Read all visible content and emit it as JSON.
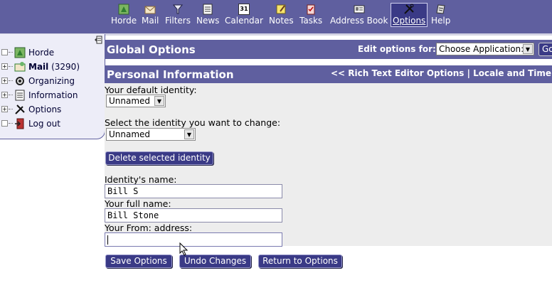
{
  "nav": {
    "items": [
      {
        "label": "Horde",
        "icon": "horde-icon"
      },
      {
        "label": "Mail",
        "icon": "mail-icon"
      },
      {
        "label": "Filters",
        "icon": "filter-icon"
      },
      {
        "label": "News",
        "icon": "news-icon"
      },
      {
        "label": "Calendar",
        "icon": "calendar-icon",
        "icon_text": "31"
      },
      {
        "label": "Notes",
        "icon": "notes-icon"
      },
      {
        "label": "Tasks",
        "icon": "tasks-icon"
      },
      {
        "label": "Address Book",
        "icon": "address-book-icon"
      },
      {
        "label": "Options",
        "icon": "options-icon",
        "active": true
      },
      {
        "label": "Help",
        "icon": "help-icon"
      }
    ]
  },
  "sidebar": {
    "items": [
      {
        "label": "Horde",
        "expand": "",
        "icon": "horde-icon"
      },
      {
        "label": "Mail",
        "count": "(3290)",
        "expand": "+",
        "icon": "mail-icon"
      },
      {
        "label": "Organizing",
        "expand": "+",
        "icon": "organizing-icon"
      },
      {
        "label": "Information",
        "expand": "+",
        "icon": "information-icon"
      },
      {
        "label": "Options",
        "expand": "+",
        "icon": "options-icon"
      },
      {
        "label": "Log out",
        "expand": "",
        "icon": "logout-icon"
      }
    ]
  },
  "global": {
    "title": "Global Options",
    "edit_label": "Edit options for:",
    "app_select_value": "Choose Application:",
    "go_label": "Go"
  },
  "personal": {
    "title": "Personal Information",
    "links": "<< Rich Text Editor Options | Locale and Time >>"
  },
  "form": {
    "default_identity_label": "Your default identity:",
    "default_identity_value": "Unnamed",
    "change_identity_label": "Select the identity you want to change:",
    "change_identity_value": "Unnamed",
    "delete_button": "Delete selected identity",
    "identity_name_label": "Identity's name:",
    "identity_name_value": "Bill S",
    "full_name_label": "Your full name:",
    "full_name_value": "Bill Stone",
    "from_address_label": "Your From: address:",
    "from_address_value": ""
  },
  "actions": {
    "save": "Save Options",
    "undo": "Undo Changes",
    "return": "Return to Options"
  },
  "colors": {
    "header": "#5f5f9f",
    "button": "#3a3a86",
    "sidebar_bg": "#ededf8",
    "panel_bg": "#ededed"
  }
}
